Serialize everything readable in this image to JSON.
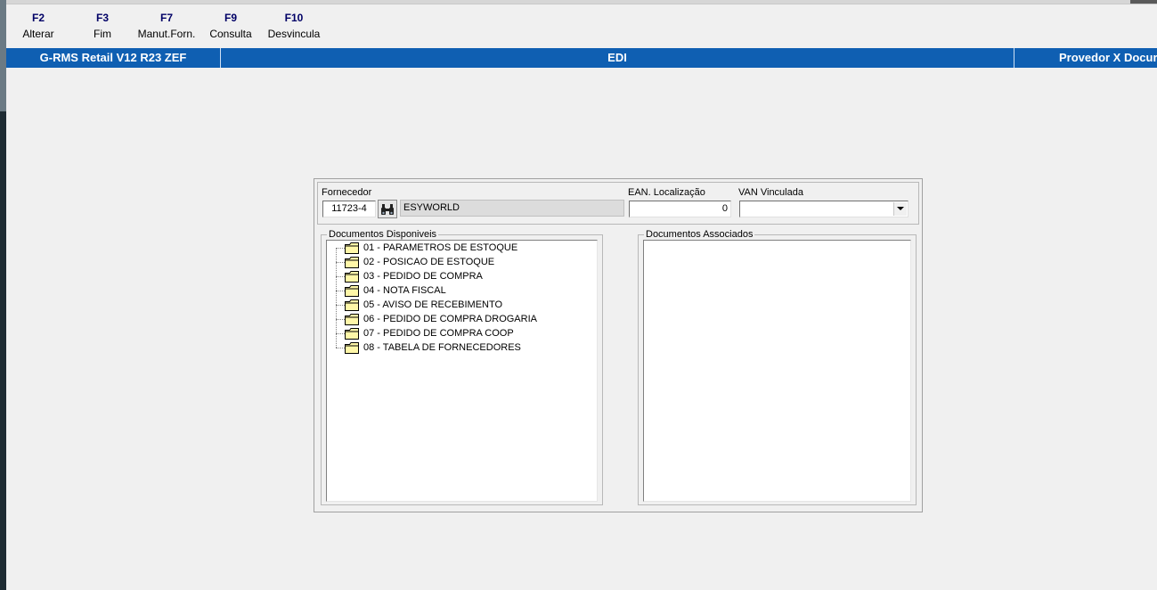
{
  "toolbar": {
    "keys": [
      {
        "key": "F2",
        "label": "Alterar"
      },
      {
        "key": "F3",
        "label": "Fim"
      },
      {
        "key": "F7",
        "label": "Manut.Forn."
      },
      {
        "key": "F9",
        "label": "Consulta"
      },
      {
        "key": "F10",
        "label": "Desvincula"
      }
    ]
  },
  "titlebar": {
    "app": "G-RMS Retail V12 R23 ZEF",
    "module": "EDI",
    "screen": "Provedor X Docur"
  },
  "form": {
    "fornecedor_label": "Fornecedor",
    "fornecedor_code": "11723-4",
    "fornecedor_name": "ESYWORLD",
    "ean_label": "EAN. Localização",
    "ean_value": "0",
    "van_label": "VAN Vinculada",
    "van_value": ""
  },
  "disponiveis": {
    "title": "Documentos Disponiveis",
    "items": [
      "01 - PARAMETROS DE ESTOQUE",
      "02 - POSICAO DE ESTOQUE",
      "03 - PEDIDO DE COMPRA",
      "04 - NOTA FISCAL",
      "05 - AVISO DE RECEBIMENTO",
      "06 - PEDIDO DE COMPRA DROGARIA",
      "07 - PEDIDO DE COMPRA COOP",
      "08 - TABELA DE FORNECEDORES"
    ]
  },
  "associados": {
    "title": "Documentos Associados",
    "items": []
  },
  "colors": {
    "titlebar": "#0f5fb2",
    "folder": "#fff7a8",
    "key_text": "#000066"
  }
}
